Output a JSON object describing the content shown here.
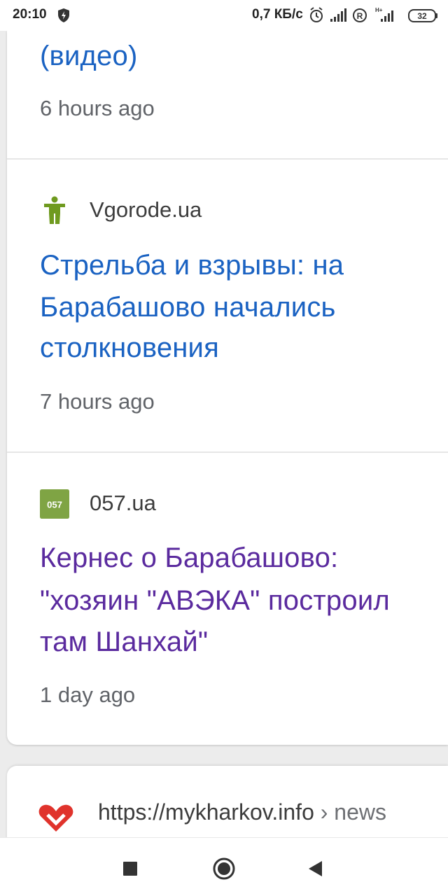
{
  "status_bar": {
    "time": "20:10",
    "network_speed": "0,7 КБ/с",
    "network_type": "H+",
    "roaming_badge": "R",
    "battery": "32",
    "icons": [
      "shield-icon",
      "alarm-icon",
      "signal-icon",
      "roaming-icon",
      "signal-icon",
      "battery-icon"
    ]
  },
  "results": [
    {
      "title_lines": [
        "(видео)"
      ],
      "time": "6 hours ago",
      "visited": false
    },
    {
      "source": "Vgorode.ua",
      "source_logo": "vgorode-logo",
      "title_lines": [
        "Стрельба и взрывы: на",
        "Барабашово начались",
        "столкновения"
      ],
      "time": "7 hours ago",
      "visited": false
    },
    {
      "source": "057.ua",
      "source_logo": "057-logo",
      "logo_text": "057",
      "title_lines": [
        "Кернес о Барабашово:",
        "\"хозяин \"АВЭКА\" построил",
        "там Шанхай\""
      ],
      "time": "1 day ago",
      "visited": true
    }
  ],
  "next_result": {
    "url": "https://mykharkov.info",
    "path": " › news",
    "logo": "mykharkov-logo"
  },
  "nav_bar": {
    "buttons": [
      "recents-button",
      "home-button",
      "back-button"
    ]
  },
  "colors": {
    "link": "#1a62c2",
    "visited_link": "#5a2a9e",
    "secondary_text": "#606368",
    "logo_057": "#7fa444",
    "logo_vgorode": "#6f9a1f",
    "logo_mykharkov": "#e0332c"
  }
}
